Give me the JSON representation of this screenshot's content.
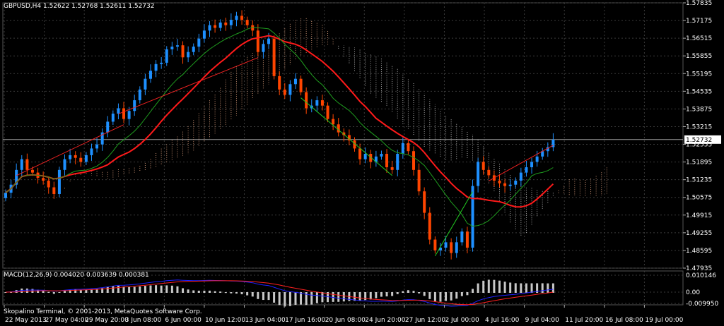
{
  "header": {
    "symbol_info": "GBPUSD,H4  1.52622 1.52768 1.52611 1.52732",
    "macd_label": "MACD(12,26,9) 0.004020 0.003639 0.000381",
    "copyright": "Skopalino Terminal, © 2001-2013, MetaQuotes Software Corp."
  },
  "price_axis": {
    "min": 1.47935,
    "max": 1.57835,
    "ticks": [
      "1.57835",
      "1.57175",
      "1.56515",
      "1.55855",
      "1.55195",
      "1.54535",
      "1.53875",
      "1.53215",
      "1.52555",
      "1.51895",
      "1.51235",
      "1.50575",
      "1.49915",
      "1.49255",
      "1.48595",
      "1.47935"
    ],
    "current_price": "1.52732"
  },
  "macd_axis": {
    "ticks": [
      "0.010146",
      "0.00",
      "-0.009950"
    ]
  },
  "time_axis": {
    "labels": [
      "22 May 2013",
      "27 May 04:00",
      "29 May 20:00",
      "3 Jun 08:00",
      "6 Jun 00:00",
      "10 Jun 12:00",
      "13 Jun 04:00",
      "17 Jun 16:00",
      "20 Jun 08:00",
      "24 Jun 20:00",
      "27 Jun 12:00",
      "2 Jul 00:00",
      "4 Jul 16:00",
      "9 Jul 04:00",
      "11 Jul 20:00",
      "16 Jul 08:00",
      "19 Jul 00:00"
    ]
  },
  "colors": {
    "background": "#000000",
    "grid": "#3a3a3a",
    "bull": "#1e90ff",
    "bear": "#ff4500",
    "ma_red": "#ff1a1a",
    "ma_green": "#1f9e1f",
    "cloud_bull": "#f4b08a",
    "cloud_bear": "#d8d8d8",
    "macd_hist": "#c8c8c8",
    "macd_line": "#2020ff",
    "signal_line": "#ff2020",
    "arrow_up": "#33ff33",
    "arrow_down": "#ff2020",
    "trend_up": "#22cc22",
    "trend_down": "#ee2222"
  },
  "chart_data": {
    "type": "candlestick",
    "timeframe": "H4",
    "symbol": "GBPUSD",
    "close_series": [
      1.5075,
      1.5105,
      1.516,
      1.52,
      1.516,
      1.515,
      1.513,
      1.512,
      1.5095,
      1.507,
      1.516,
      1.52,
      1.5215,
      1.5205,
      1.519,
      1.5215,
      1.524,
      1.5255,
      1.53,
      1.534,
      1.537,
      1.539,
      1.535,
      1.538,
      1.542,
      1.546,
      1.55,
      1.553,
      1.5555,
      1.556,
      1.561,
      1.562,
      1.5625,
      1.558,
      1.56,
      1.562,
      1.565,
      1.568,
      1.57,
      1.569,
      1.571,
      1.57,
      1.572,
      1.5735,
      1.572,
      1.57,
      1.568,
      1.56,
      1.563,
      1.565,
      1.551,
      1.546,
      1.544,
      1.548,
      1.55,
      1.545,
      1.539,
      1.54,
      1.542,
      1.54,
      1.535,
      1.533,
      1.53,
      1.529,
      1.527,
      1.524,
      1.52,
      1.522,
      1.519,
      1.521,
      1.522,
      1.517,
      1.516,
      1.522,
      1.526,
      1.523,
      1.516,
      1.508,
      1.5,
      1.49,
      1.486,
      1.487,
      1.489,
      1.485,
      1.489,
      1.493,
      1.487,
      1.51,
      1.519,
      1.516,
      1.514,
      1.512,
      1.511,
      1.51,
      1.5105,
      1.512,
      1.515,
      1.517,
      1.519,
      1.521,
      1.523,
      1.5245,
      1.5273
    ],
    "overlays": [
      "Moving Average (red)",
      "Moving Average (green)",
      "Ichimoku Cloud",
      "Trend lines"
    ],
    "subchart": {
      "type": "MACD",
      "fast": 12,
      "slow": 26,
      "signal": 9,
      "values": [
        0.00402,
        0.003639,
        0.000381
      ]
    }
  }
}
